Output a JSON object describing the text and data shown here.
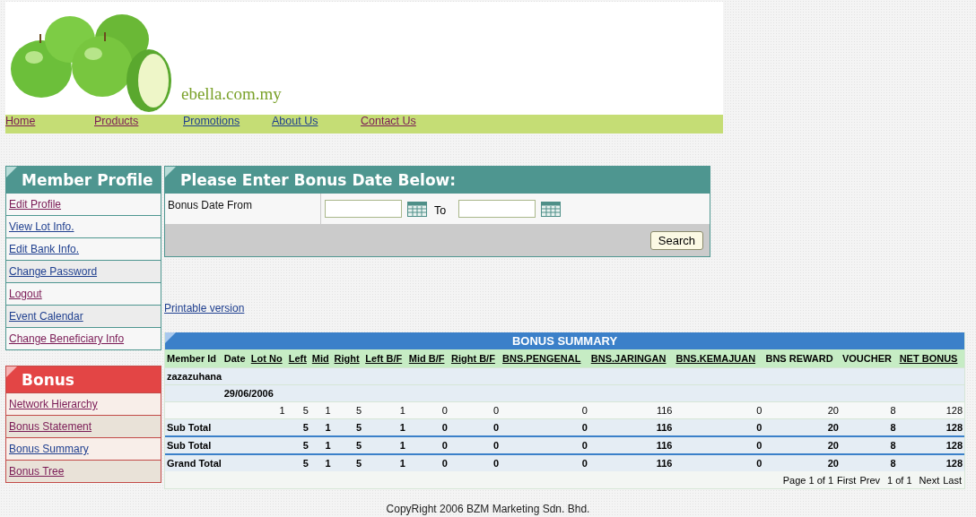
{
  "site": {
    "name": "ebella.com.my"
  },
  "nav": [
    {
      "label": "Home",
      "visited": true
    },
    {
      "label": "Products",
      "visited": true
    },
    {
      "label": "Promotions",
      "visited": false
    },
    {
      "label": "About Us",
      "visited": false
    },
    {
      "label": "Contact Us",
      "visited": true
    }
  ],
  "member_menu": {
    "title": "Member Profile",
    "items": [
      {
        "label": "Edit Profile",
        "visited": true
      },
      {
        "label": "View Lot Info.",
        "visited": false
      },
      {
        "label": "Edit Bank Info.",
        "visited": false
      },
      {
        "label": "Change Password",
        "visited": false
      },
      {
        "label": "Logout",
        "visited": true
      },
      {
        "label": "Event Calendar",
        "visited": false
      },
      {
        "label": "Change Beneficiary Info",
        "visited": true
      }
    ]
  },
  "bonus_menu": {
    "title": "Bonus",
    "items": [
      {
        "label": "Network Hierarchy",
        "visited": true
      },
      {
        "label": "Bonus Statement",
        "visited": true
      },
      {
        "label": "Bonus Summary",
        "visited": false
      },
      {
        "label": "Bonus Tree",
        "visited": true
      }
    ]
  },
  "date_form": {
    "title": "Please Enter Bonus Date Below:",
    "label": "Bonus Date From",
    "to_label": "To",
    "button": "Search"
  },
  "printable_link": "Printable version",
  "summary": {
    "title": "BONUS SUMMARY",
    "columns": [
      {
        "label": "Member Id",
        "sortable": false
      },
      {
        "label": "Date",
        "sortable": false
      },
      {
        "label": "Lot No",
        "sortable": true
      },
      {
        "label": "Left",
        "sortable": true
      },
      {
        "label": "Mid",
        "sortable": true
      },
      {
        "label": "Right",
        "sortable": true
      },
      {
        "label": "Left B/F",
        "sortable": true
      },
      {
        "label": "Mid B/F",
        "sortable": true
      },
      {
        "label": "Right B/F",
        "sortable": true
      },
      {
        "label": "BNS.PENGENAL",
        "sortable": true
      },
      {
        "label": "BNS.JARINGAN",
        "sortable": true
      },
      {
        "label": "BNS.KEMAJUAN",
        "sortable": true
      },
      {
        "label": "BNS REWARD",
        "sortable": false
      },
      {
        "label": "VOUCHER",
        "sortable": false
      },
      {
        "label": "NET BONUS",
        "sortable": true
      }
    ],
    "rows": [
      {
        "kind": "member",
        "label": "zazazuhana"
      },
      {
        "kind": "date",
        "label": "29/06/2006"
      },
      {
        "kind": "detail",
        "values": [
          "1",
          "5",
          "1",
          "5",
          "1",
          "0",
          "0",
          "0",
          "116",
          "0",
          "20",
          "8",
          "128"
        ]
      },
      {
        "kind": "total",
        "label": "Sub Total",
        "divider_above": false,
        "values": [
          "5",
          "1",
          "5",
          "1",
          "0",
          "0",
          "0",
          "116",
          "0",
          "20",
          "8",
          "128"
        ]
      },
      {
        "kind": "total",
        "label": "Sub Total",
        "divider_above": true,
        "values": [
          "5",
          "1",
          "5",
          "1",
          "0",
          "0",
          "0",
          "116",
          "0",
          "20",
          "8",
          "128"
        ]
      },
      {
        "kind": "total",
        "label": "Grand Total",
        "divider_above": true,
        "values": [
          "5",
          "1",
          "5",
          "1",
          "0",
          "0",
          "0",
          "116",
          "0",
          "20",
          "8",
          "128"
        ]
      }
    ],
    "pager": {
      "info": "Page 1 of 1",
      "first": "First",
      "prev": "Prev",
      "position": "1 of 1",
      "next": "Next",
      "last": "Last"
    }
  },
  "footer": "CopyRight 2006 BZM Marketing Sdn. Bhd."
}
